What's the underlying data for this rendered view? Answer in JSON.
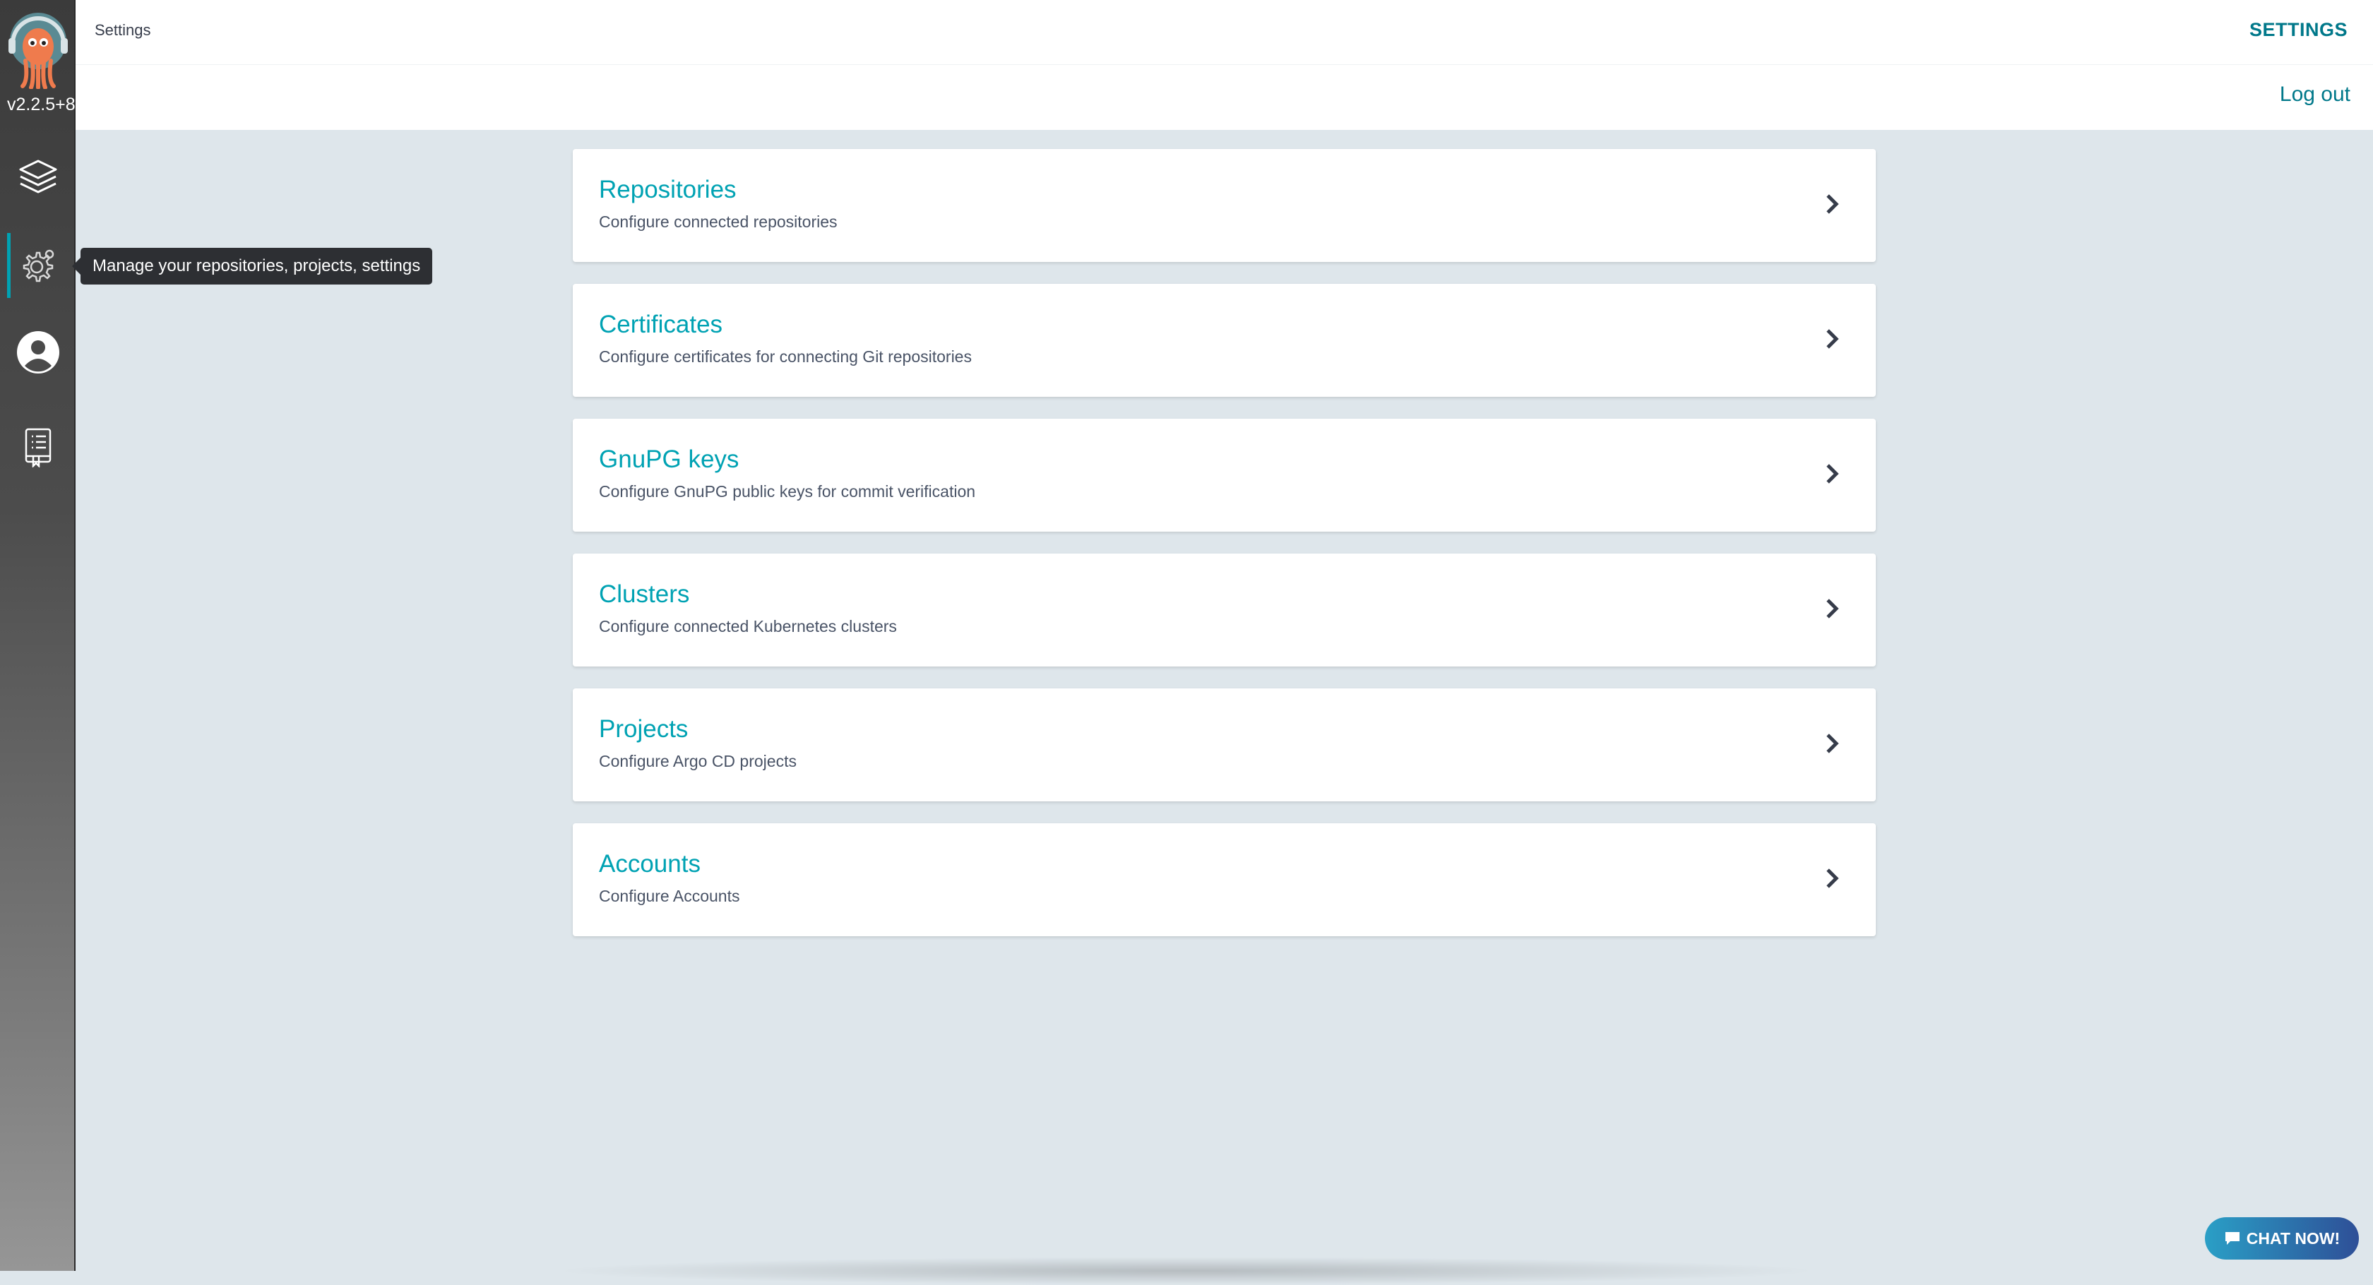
{
  "sidebar": {
    "version": "v2.2.5+8",
    "tooltip": "Manage your repositories, projects, settings",
    "items": [
      {
        "icon": "layers-icon"
      },
      {
        "icon": "gear-icon",
        "active": true
      },
      {
        "icon": "user-icon"
      },
      {
        "icon": "docs-icon"
      }
    ]
  },
  "header": {
    "page_title": "Settings",
    "section": "SETTINGS",
    "logout": "Log out"
  },
  "cards": [
    {
      "title": "Repositories",
      "desc": "Configure connected repositories"
    },
    {
      "title": "Certificates",
      "desc": "Configure certificates for connecting Git repositories"
    },
    {
      "title": "GnuPG keys",
      "desc": "Configure GnuPG public keys for commit verification"
    },
    {
      "title": "Clusters",
      "desc": "Configure connected Kubernetes clusters"
    },
    {
      "title": "Projects",
      "desc": "Configure Argo CD projects"
    },
    {
      "title": "Accounts",
      "desc": "Configure Accounts"
    }
  ],
  "chat": {
    "label": "CHAT NOW!"
  },
  "colors": {
    "accent": "#00a2b3",
    "link": "#00788a",
    "background": "#dee6eb"
  }
}
